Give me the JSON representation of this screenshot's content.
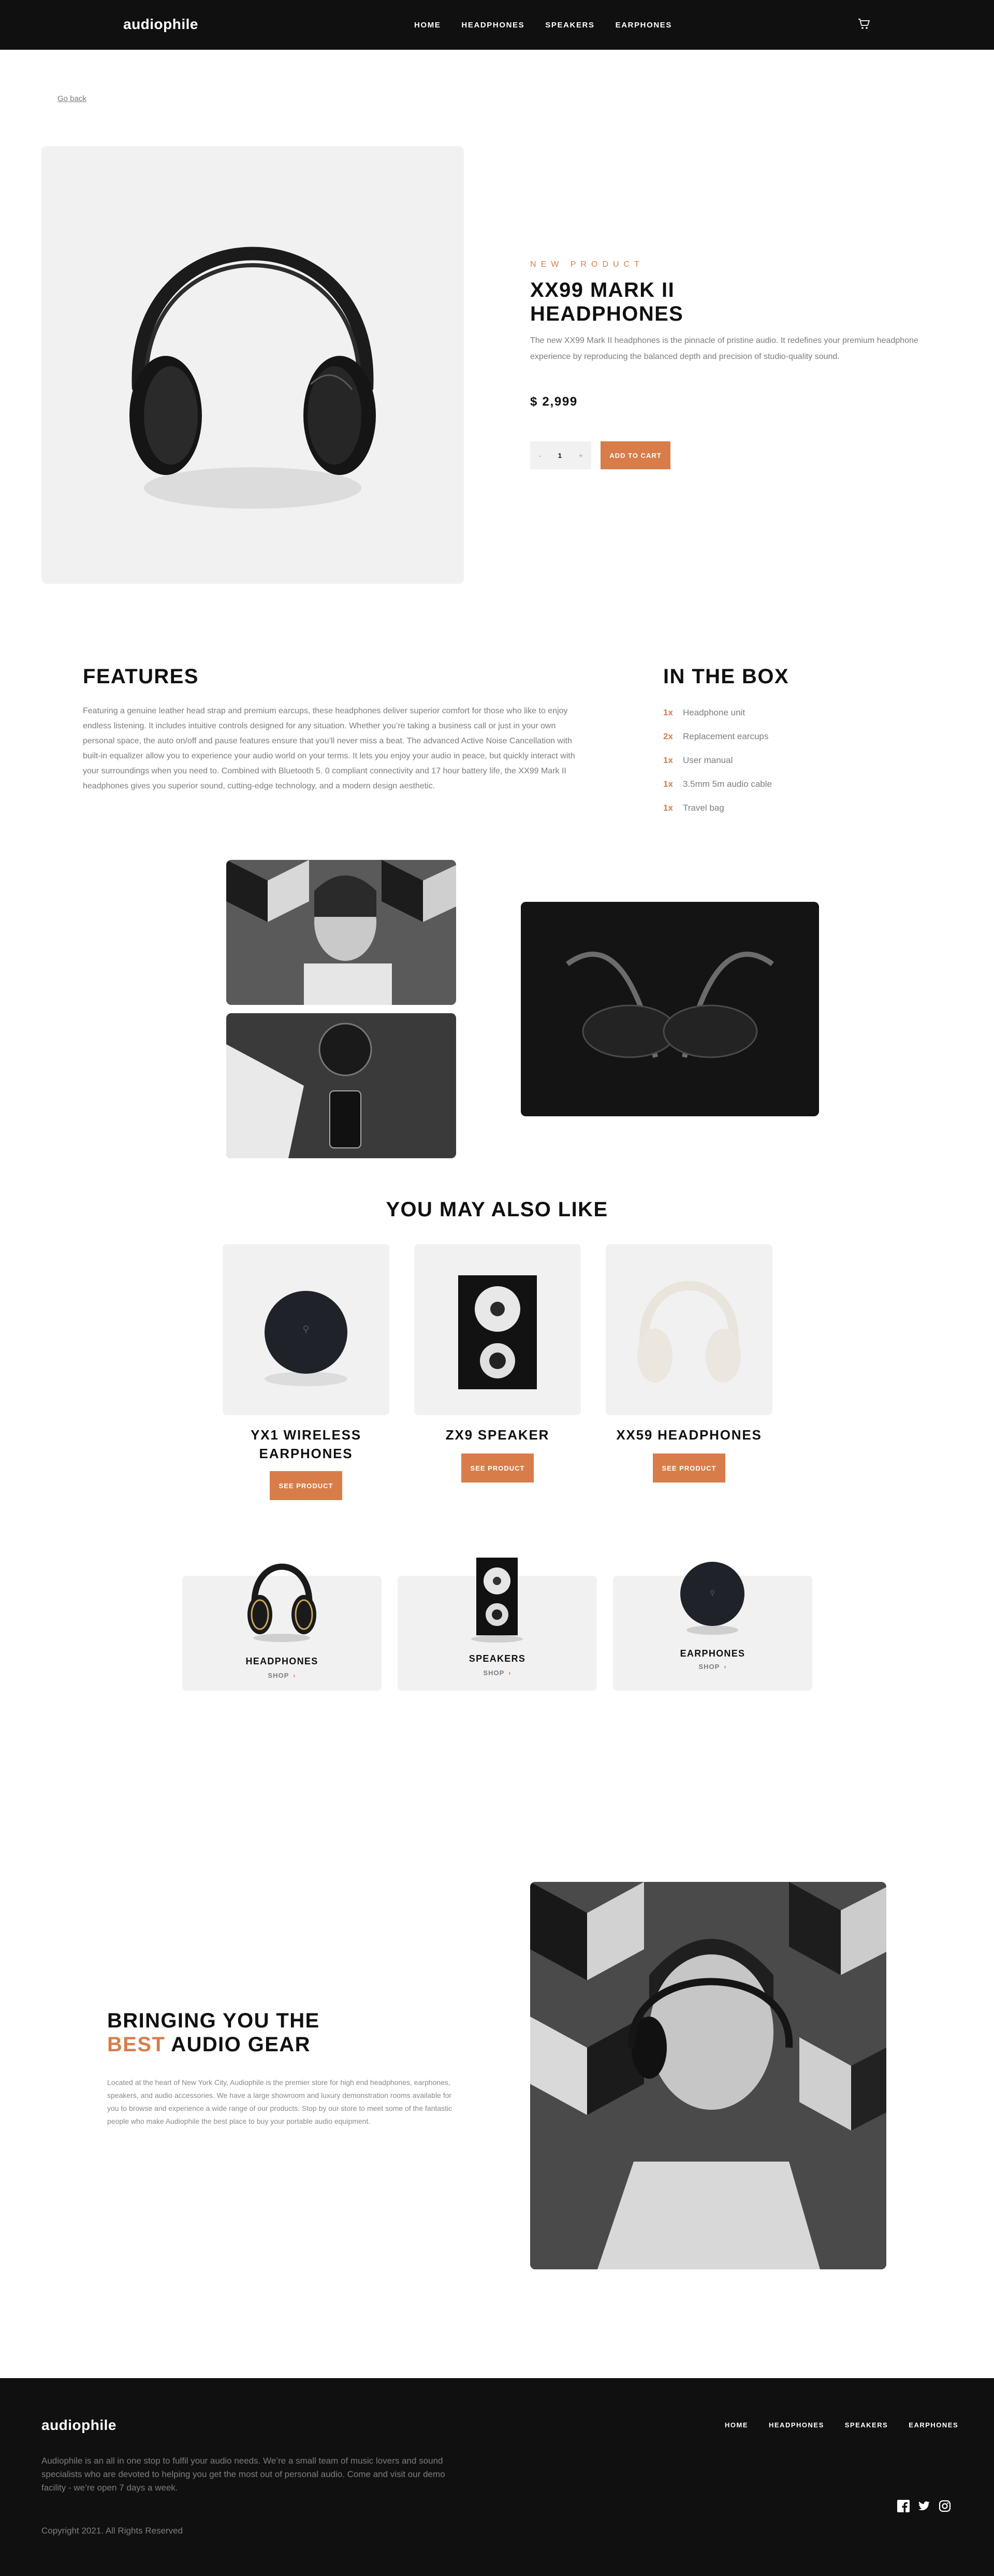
{
  "brand": {
    "name": "audiophile",
    "accent": "#D87D4A",
    "dark": "#101010",
    "light_bg": "#F1F1F1"
  },
  "header": {
    "nav": [
      "HOME",
      "HEADPHONES",
      "SPEAKERS",
      "EARPHONES"
    ],
    "cart_icon": "cart-icon"
  },
  "go_back": "Go back",
  "product": {
    "overline": "NEW PRODUCT",
    "title": "XX99 MARK II HEADPHONES",
    "description": "The new XX99 Mark II headphones is the pinnacle of pristine audio. It redefines your premium headphone experience by reproducing the balanced depth and precision of studio-quality sound.",
    "price": "$ 2,999",
    "quantity": "1",
    "qty_minus": "-",
    "qty_plus": "+",
    "add_to_cart": "ADD TO CART"
  },
  "features": {
    "title": "FEATURES",
    "text": "Featuring a genuine leather head strap and premium earcups, these headphones deliver superior comfort for those who like to enjoy endless listening. It includes intuitive controls designed for any situation. Whether you’re taking a business call or just in your own personal space, the auto on/off and pause features ensure that you’ll never miss a beat. The advanced Active Noise Cancellation with built-in equalizer allow you to experience your audio world on your terms. It lets you enjoy your audio in peace, but quickly interact with your surroundings when you need to. Combined with Bluetooth 5. 0 compliant connectivity and 17 hour battery life, the XX99 Mark II headphones gives you superior sound, cutting-edge technology, and a modern design aesthetic."
  },
  "in_the_box": {
    "title": "IN THE BOX",
    "items": [
      {
        "qty": "1x",
        "name": "Headphone unit"
      },
      {
        "qty": "2x",
        "name": "Replacement earcups"
      },
      {
        "qty": "1x",
        "name": "User manual"
      },
      {
        "qty": "1x",
        "name": "3.5mm 5m audio cable"
      },
      {
        "qty": "1x",
        "name": "Travel bag"
      }
    ]
  },
  "also_like": {
    "title": "YOU MAY ALSO LIKE",
    "items": [
      {
        "name": "YX1 WIRELESS EARPHONES",
        "button": "SEE PRODUCT"
      },
      {
        "name": "ZX9 SPEAKER",
        "button": "SEE PRODUCT"
      },
      {
        "name": "XX59 HEADPHONES",
        "button": "SEE PRODUCT"
      }
    ]
  },
  "categories": [
    {
      "label": "HEADPHONES",
      "shop": "SHOP"
    },
    {
      "label": "SPEAKERS",
      "shop": "SHOP"
    },
    {
      "label": "EARPHONES",
      "shop": "SHOP"
    }
  ],
  "about": {
    "title_line1": "BRINGING YOU THE",
    "title_accent": "BEST",
    "title_line2_rest": " AUDIO GEAR",
    "text": "Located at the heart of New York City, Audiophile is the premier store for high end headphones, earphones, speakers, and audio accessories. We have a large showroom and luxury demonstration rooms available for you to browse and experience a wide range of our products. Stop by our store to meet some of the fantastic people who make Audiophile the best place to buy your portable audio equipment."
  },
  "footer": {
    "nav": [
      "HOME",
      "HEADPHONES",
      "SPEAKERS",
      "EARPHONES"
    ],
    "text": "Audiophile is an all in one stop to fulfil your audio needs. We’re a small team of music lovers and sound specialists who are devoted to helping you get the most out of personal audio. Come and visit our demo facility - we’re open 7 days a week.",
    "copyright": "Copyright 2021. All Rights Reserved",
    "social": [
      "facebook-icon",
      "twitter-icon",
      "instagram-icon"
    ]
  }
}
